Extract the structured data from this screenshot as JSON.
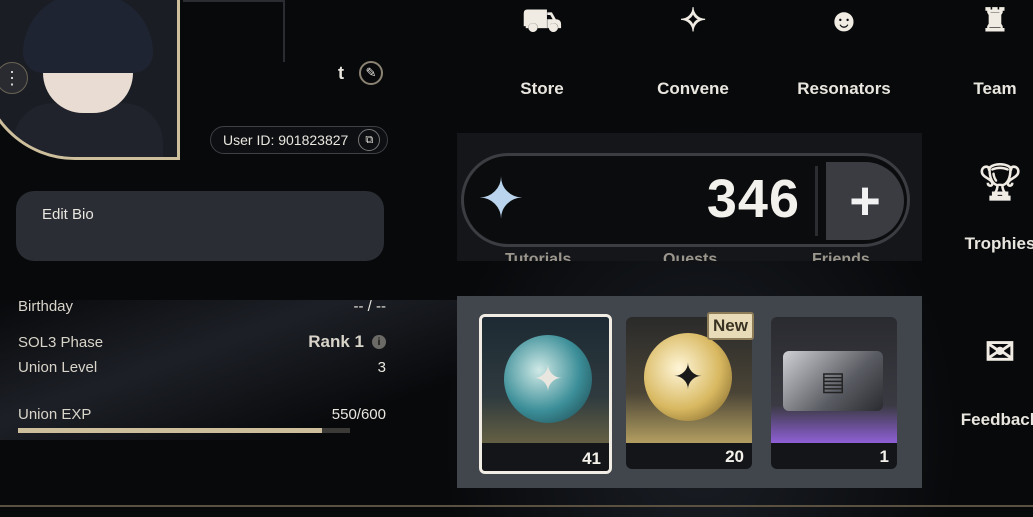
{
  "profile": {
    "name": "t",
    "user_id": "User ID: 901823827",
    "edit_bio": "Edit Bio",
    "stats": [
      {
        "label": "Birthday",
        "value": "-- / --"
      },
      {
        "label": "SOL3 Phase",
        "value": "Rank 1"
      },
      {
        "label": "Union Level",
        "value": "3"
      },
      {
        "label": "Union EXP",
        "value": "550/600"
      }
    ],
    "exp_progress": 0.917
  },
  "nav": {
    "store": "Store",
    "convene": "Convene",
    "resonators": "Resonators",
    "team": "Team"
  },
  "currency": {
    "amount": "346",
    "plus": "+"
  },
  "hidden_labels": {
    "tutorials": "Tutorials",
    "quests": "Quests",
    "friends": "Friends"
  },
  "items": {
    "new_badge": "New",
    "list": [
      {
        "icon": "lustrous-tide-icon",
        "count": "41"
      },
      {
        "icon": "radiant-tide-icon",
        "count": "20"
      },
      {
        "icon": "supply-crate-icon",
        "count": "1"
      }
    ]
  },
  "side": {
    "trophies": "Trophies",
    "feedback": "Feedback"
  },
  "colors": {
    "accent_gold": "#cdbf9c",
    "purple_rarity": "#b07cff",
    "gold_rarity": "#e3cf8a"
  }
}
